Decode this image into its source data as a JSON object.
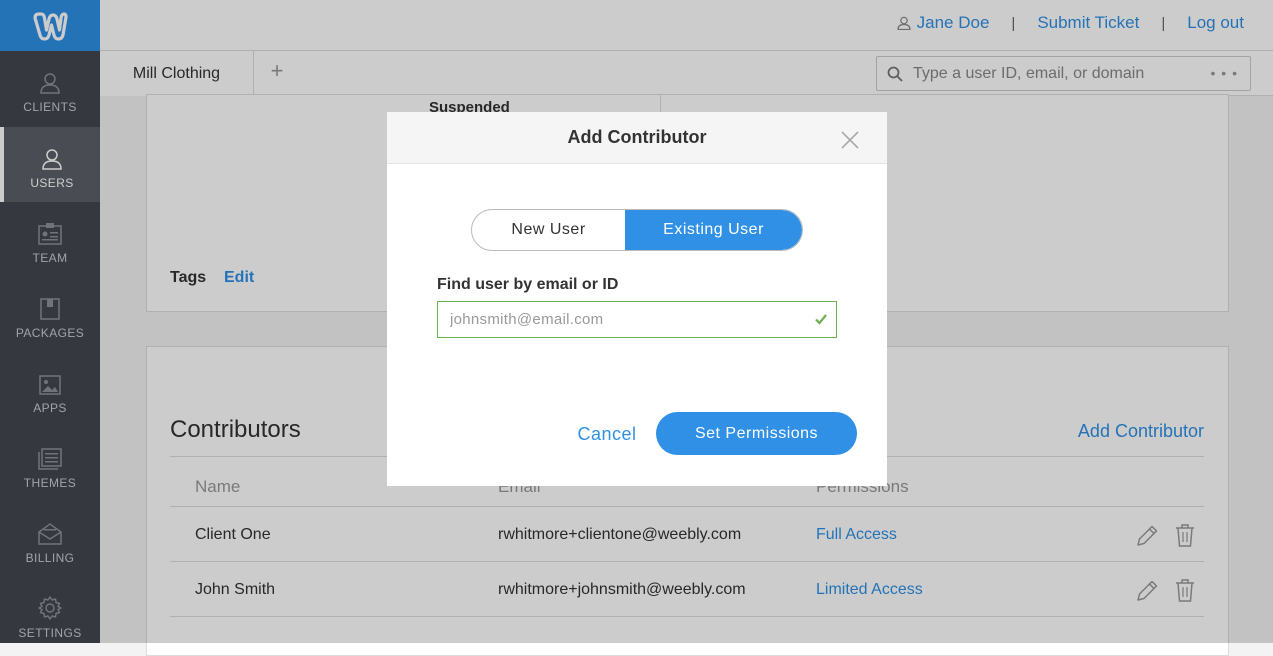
{
  "brand": {
    "accent": "#2f90e5",
    "logo_icon": "weebly-w-icon"
  },
  "sidebar": {
    "items": [
      {
        "label": "CLIENTS",
        "icon": "user-icon",
        "active": false
      },
      {
        "label": "USERS",
        "icon": "user-icon",
        "active": true
      },
      {
        "label": "TEAM",
        "icon": "id-card-icon",
        "active": false
      },
      {
        "label": "PACKAGES",
        "icon": "package-icon",
        "active": false
      },
      {
        "label": "APPS",
        "icon": "image-icon",
        "active": false
      },
      {
        "label": "THEMES",
        "icon": "themes-icon",
        "active": false
      },
      {
        "label": "BILLING",
        "icon": "envelope-icon",
        "active": false
      },
      {
        "label": "SETTINGS",
        "icon": "gear-icon",
        "active": false
      }
    ]
  },
  "topbar": {
    "user_name": "Jane Doe",
    "submit_ticket": "Submit Ticket",
    "logout": "Log out",
    "separator": "|"
  },
  "tabs": {
    "active_tab": "Mill Clothing",
    "add_symbol": "+",
    "search_placeholder": "Type a user ID, email, or domain",
    "search_more": "• • •"
  },
  "details": {
    "status": "Suspended",
    "tags_label": "Tags",
    "tags_edit": "Edit"
  },
  "contributors": {
    "title": "Contributors",
    "add_link": "Add Contributor",
    "columns": {
      "name": "Name",
      "email": "Email",
      "permissions": "Permissions"
    },
    "rows": [
      {
        "name": "Client One",
        "email": "rwhitmore+clientone@weebly.com",
        "permissions": "Full Access"
      },
      {
        "name": "John Smith",
        "email": "rwhitmore+johnsmith@weebly.com",
        "permissions": "Limited Access"
      }
    ]
  },
  "modal": {
    "title": "Add Contributor",
    "toggle": {
      "new_user": "New User",
      "existing_user": "Existing User",
      "selected": "Existing User"
    },
    "field_label": "Find user by email or ID",
    "field_placeholder": "johnsmith@email.com",
    "field_valid": true,
    "cancel": "Cancel",
    "submit": "Set Permissions"
  }
}
